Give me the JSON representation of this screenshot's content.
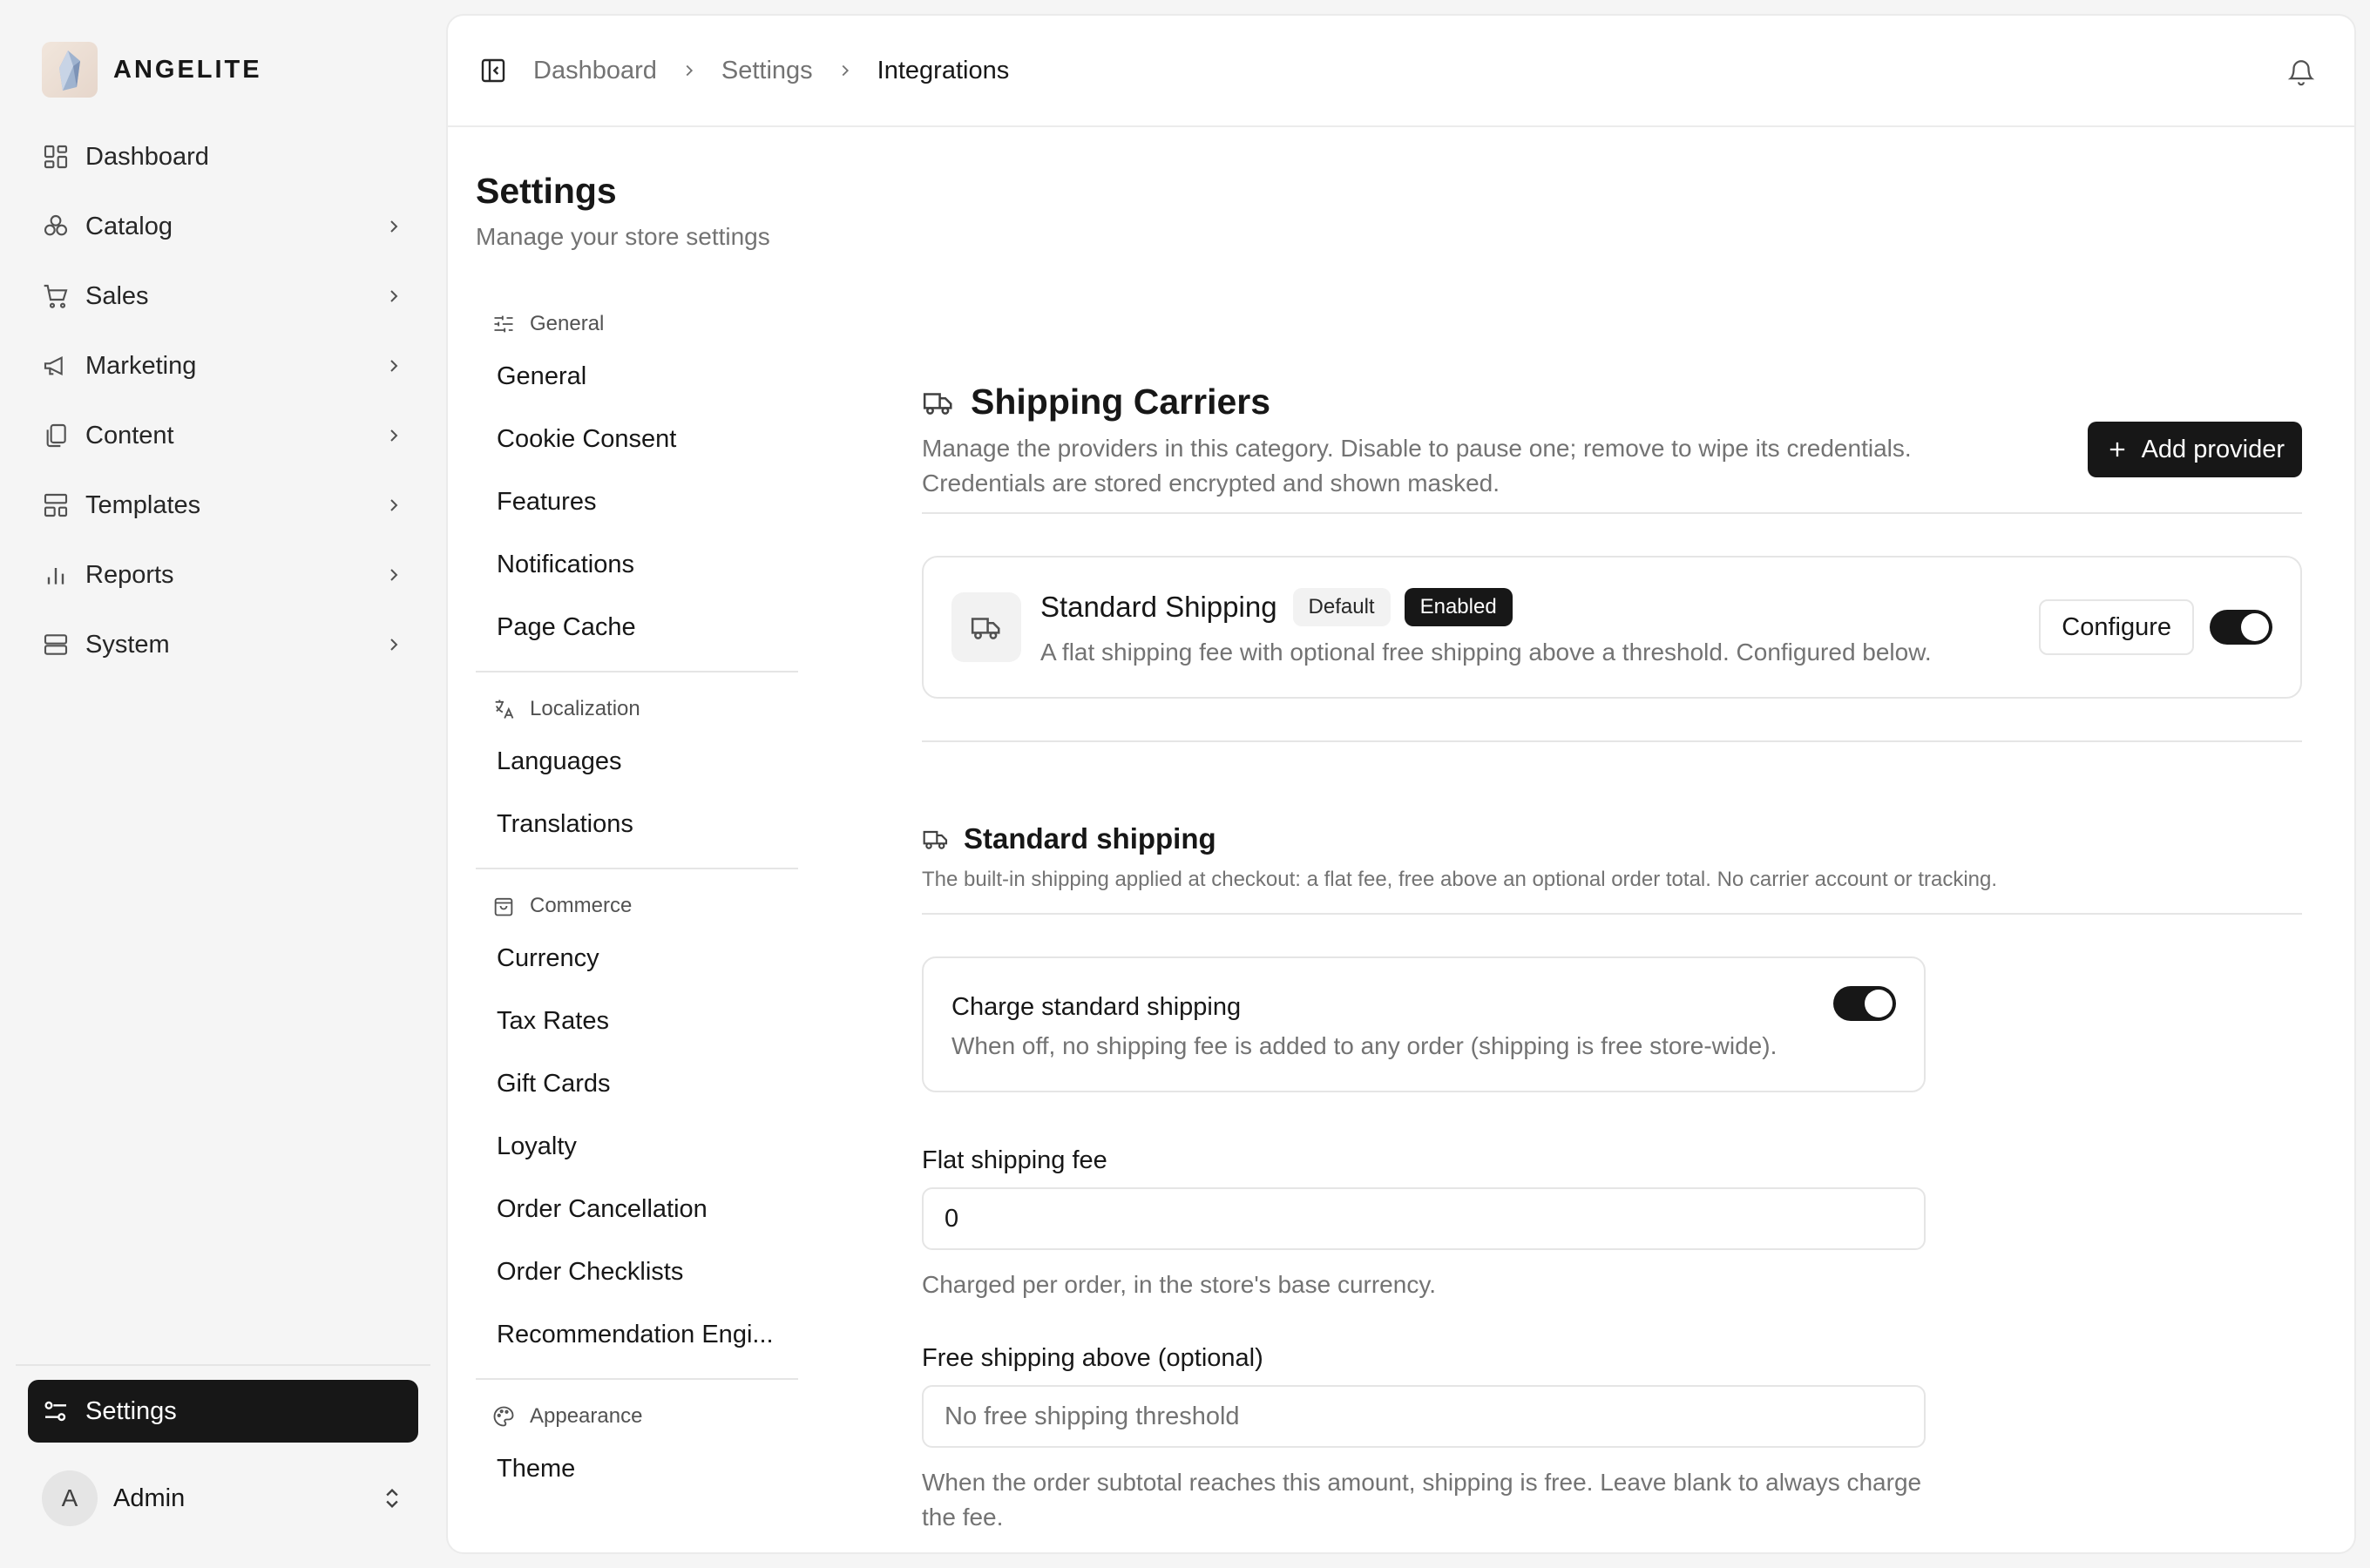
{
  "app": {
    "brand": "ANGELITE"
  },
  "nav": {
    "items": [
      {
        "label": "Dashboard",
        "icon": "layout-dashboard-icon"
      },
      {
        "label": "Catalog",
        "icon": "boxes-icon"
      },
      {
        "label": "Sales",
        "icon": "shopping-cart-icon"
      },
      {
        "label": "Marketing",
        "icon": "megaphone-icon"
      },
      {
        "label": "Content",
        "icon": "files-icon"
      },
      {
        "label": "Templates",
        "icon": "layout-template-icon"
      },
      {
        "label": "Reports",
        "icon": "bar-chart-icon"
      },
      {
        "label": "System",
        "icon": "server-icon"
      }
    ],
    "settings_label": "Settings",
    "user": {
      "initial": "A",
      "name": "Admin"
    }
  },
  "breadcrumb": {
    "items": [
      "Dashboard",
      "Settings"
    ],
    "current": "Integrations"
  },
  "page": {
    "title": "Settings",
    "subtitle": "Manage your store settings"
  },
  "subnav": {
    "groups": [
      {
        "label": "General",
        "items": [
          "General",
          "Cookie Consent",
          "Features",
          "Notifications",
          "Page Cache"
        ]
      },
      {
        "label": "Localization",
        "items": [
          "Languages",
          "Translations"
        ]
      },
      {
        "label": "Commerce",
        "items": [
          "Currency",
          "Tax Rates",
          "Gift Cards",
          "Loyalty",
          "Order Cancellation",
          "Order Checklists",
          "Recommendation Engi..."
        ]
      },
      {
        "label": "Appearance",
        "items": [
          "Theme"
        ]
      }
    ]
  },
  "carriers": {
    "title": "Shipping Carriers",
    "description": "Manage the providers in this category. Disable to pause one; remove to wipe its credentials. Credentials are stored encrypted and shown masked.",
    "add_label": "Add provider",
    "provider": {
      "name": "Standard Shipping",
      "badge_default": "Default",
      "badge_enabled": "Enabled",
      "description": "A flat shipping fee with optional free shipping above a threshold. Configured below.",
      "configure_label": "Configure",
      "enabled": true
    }
  },
  "standard": {
    "title": "Standard shipping",
    "description": "The built-in shipping applied at checkout: a flat fee, free above an optional order total. No carrier account or tracking.",
    "charge": {
      "title": "Charge standard shipping",
      "description": "When off, no shipping fee is added to any order (shipping is free store-wide).",
      "enabled": true
    },
    "flat_fee": {
      "label": "Flat shipping fee",
      "value": "0",
      "help": "Charged per order, in the store's base currency."
    },
    "free_above": {
      "label": "Free shipping above (optional)",
      "value": "",
      "placeholder": "No free shipping threshold",
      "help": "When the order subtotal reaches this amount, shipping is free. Leave blank to always charge the fee."
    }
  }
}
